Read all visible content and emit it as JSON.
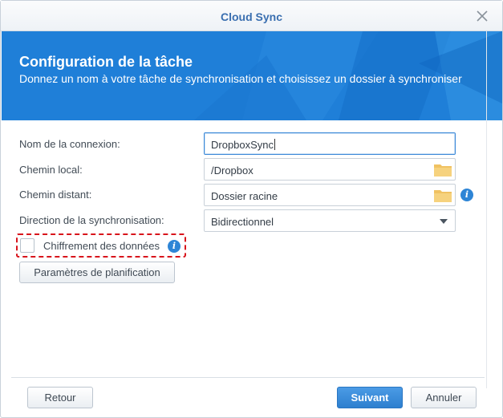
{
  "window": {
    "title": "Cloud Sync"
  },
  "banner": {
    "title": "Configuration de la tâche",
    "subtitle": "Donnez un nom à votre tâche de synchronisation et choisissez un dossier à synchroniser"
  },
  "form": {
    "connection_name": {
      "label": "Nom de la connexion:",
      "value": "DropboxSync"
    },
    "local_path": {
      "label": "Chemin local:",
      "value": "/Dropbox"
    },
    "remote_path": {
      "label": "Chemin distant:",
      "value": "Dossier racine"
    },
    "sync_direction": {
      "label": "Direction de la synchronisation:",
      "value": "Bidirectionnel"
    },
    "encryption": {
      "label": "Chiffrement des données",
      "checked": false
    },
    "schedule_button": "Paramètres de planification"
  },
  "footer": {
    "back": "Retour",
    "next": "Suivant",
    "cancel": "Annuler"
  },
  "colors": {
    "accent": "#1f80d9",
    "title": "#3a6fb0",
    "highlight": "#d8141c"
  }
}
